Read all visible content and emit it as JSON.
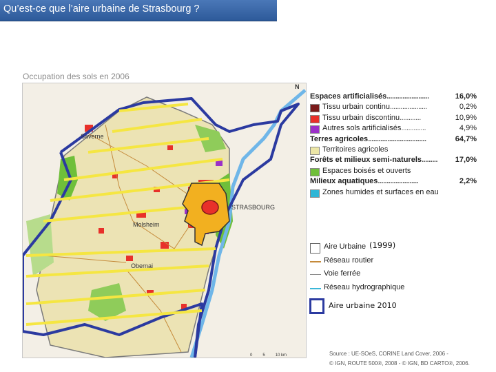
{
  "slide": {
    "title": "Qu’est-ce que l’aire urbaine de Strasbourg ?",
    "title_bg": "#3a68aa"
  },
  "map": {
    "caption": "Occupation des sols en 2006",
    "north_label": "N",
    "places": {
      "saverne": "Saverne",
      "strasbourg": "STRASBOURG",
      "molsheim": "Molsheim",
      "obernai": "Obernai"
    },
    "scale": {
      "zero": "0",
      "mid": "5",
      "end": "10 km"
    }
  },
  "legend": {
    "groups": [
      {
        "label": "Espaces artificialisés",
        "value": "16,0%",
        "dots": "........................",
        "items": [
          {
            "label": "Tissu urbain continu",
            "value": "0,2%",
            "color": "#7a1a1a",
            "dots": "....................."
          },
          {
            "label": "Tissu urbain discontinu",
            "value": "10,9%",
            "color": "#e8302a",
            "dots": "............"
          },
          {
            "label": "Autres sols artificialisés",
            "value": "4,9%",
            "color": "#9b30c8",
            "dots": ".............."
          }
        ]
      },
      {
        "label": "Terres agricoles",
        "value": "64,7%",
        "dots": ".................................",
        "items": [
          {
            "label": "Territoires agricoles",
            "value": "",
            "color": "#ece6a6",
            "dots": ""
          }
        ]
      },
      {
        "label": "Forêts et milieux semi-naturels",
        "value": "17,0%",
        "dots": ".........",
        "items": [
          {
            "label": "Espaces boisés et ouverts",
            "value": "",
            "color": "#6fbf3a",
            "dots": ""
          }
        ]
      },
      {
        "label": "Milieux aquatiques",
        "value": "2,2%",
        "dots": ".......................",
        "items": [
          {
            "label": "Zones humides et surfaces en eau",
            "value": "",
            "color": "#2fb6d6",
            "dots": ""
          }
        ]
      }
    ],
    "lines": [
      {
        "label": "Aire Urbaine",
        "symbol": "box"
      },
      {
        "label": "Réseau routier",
        "symbol": "line",
        "color": "#c58a3a"
      },
      {
        "label": "Voie ferrée",
        "symbol": "line",
        "color": "#8a8a8a"
      },
      {
        "label": "Réseau hydrographique",
        "symbol": "line",
        "color": "#3bb7d8"
      }
    ],
    "year_note": "(1999)",
    "aire_2010_label": "Aire urbaine 2010",
    "aire_2010_color": "#2b3aa0",
    "yellow_hatch_color": "#f5e642",
    "hand_color": "#f2b020"
  },
  "source": {
    "line1": "Source : UE-SOeS, CORINE Land Cover, 2006  -",
    "line2": "© IGN, ROUTE 500®, 2008 - © IGN, BD CARTO®, 2006."
  }
}
